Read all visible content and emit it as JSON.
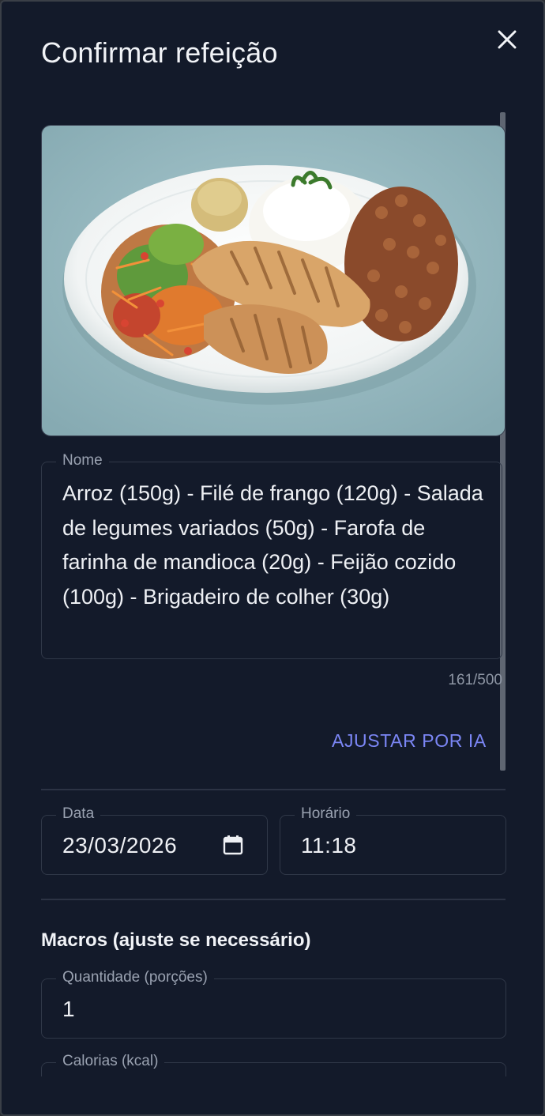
{
  "dialog": {
    "title": "Confirmar refeição",
    "close_icon": "close-icon"
  },
  "meal": {
    "photo_alt": "Prato de comida",
    "name_label": "Nome",
    "name_value": "Arroz (150g) - Filé de frango (120g) - Salada de legumes variados (50g) - Farofa de farinha de mandioca (20g) - Feijão cozido (100g) - Brigadeiro de colher (30g)",
    "counter": "161/500",
    "ai_button": "AJUSTAR POR IA"
  },
  "datetime": {
    "date_label": "Data",
    "date_value": "23/03/2026",
    "time_label": "Horário",
    "time_value": "11:18"
  },
  "macros": {
    "section_title": "Macros (ajuste se necessário)",
    "quantity_label": "Quantidade (porções)",
    "quantity_value": "1",
    "calories_label": "Calorias (kcal)"
  },
  "colors": {
    "background": "#131a2a",
    "accent": "#7b86f5",
    "border": "#303848"
  }
}
